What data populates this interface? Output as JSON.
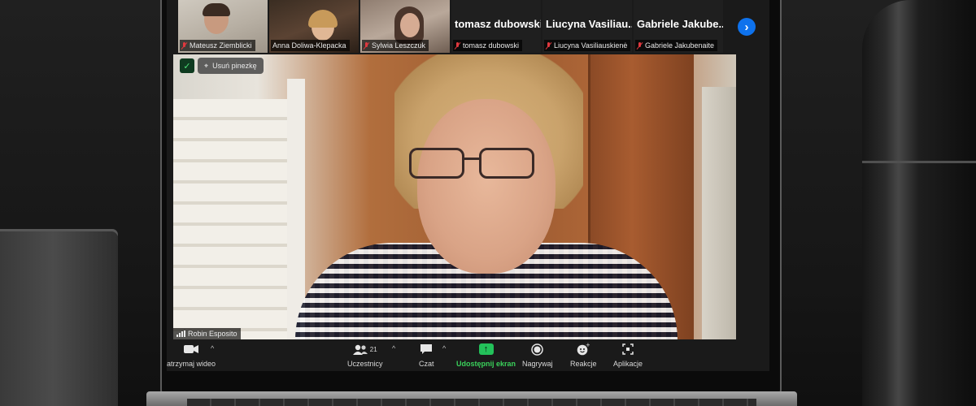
{
  "gallery": {
    "tiles": [
      {
        "name": "Mateusz Ziemblicki",
        "has_video": true
      },
      {
        "name": "Anna Doliwa-Klepacka",
        "has_video": true
      },
      {
        "name": "Sylwia Leszczuk",
        "has_video": true
      },
      {
        "name": "tomasz dubowski",
        "big_name": "tomasz dubowski",
        "has_video": false
      },
      {
        "name": "Liucyna Vasiliauskienė",
        "big_name": "Liucyna  Vasiliau...",
        "has_video": false
      },
      {
        "name": "Gabriele Jakubenaite",
        "big_name": "Gabriele  Jakube...",
        "has_video": false
      }
    ],
    "next_icon": "chevron-right-icon"
  },
  "main_video": {
    "unpin_label": "Usuń pinezkę",
    "speaker_name": "Robin Esposito"
  },
  "toolbar": {
    "video_label": "atrzymaj wideo",
    "participants_label": "Uczestnicy",
    "participants_count": "21",
    "chat_label": "Czat",
    "share_label": "Udostępnij ekran",
    "record_label": "Nagrywaj",
    "reactions_label": "Reakcje",
    "apps_label": "Aplikacje"
  },
  "colors": {
    "share_green": "#23c15a",
    "mic_off_red": "#e0383e",
    "accent_blue": "#0e72ed"
  }
}
